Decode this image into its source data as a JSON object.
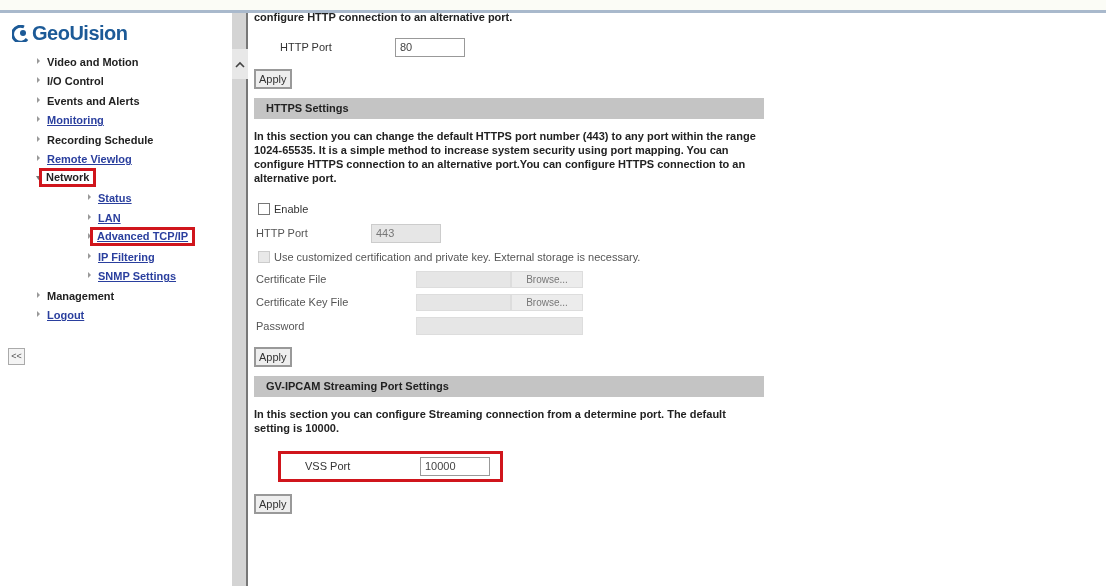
{
  "logo": {
    "text": "GeoUision"
  },
  "nav": [
    {
      "label": "Video and Motion",
      "kind": "plain",
      "expanded": false,
      "highlighted": false
    },
    {
      "label": "I/O Control",
      "kind": "plain",
      "expanded": false,
      "highlighted": false
    },
    {
      "label": "Events and Alerts",
      "kind": "plain",
      "expanded": false,
      "highlighted": false
    },
    {
      "label": "Monitoring",
      "kind": "link",
      "expanded": false,
      "highlighted": false
    },
    {
      "label": "Recording Schedule",
      "kind": "plain",
      "expanded": false,
      "highlighted": false
    },
    {
      "label": "Remote Viewlog",
      "kind": "link",
      "expanded": false,
      "highlighted": false
    },
    {
      "label": "Network",
      "kind": "plain",
      "expanded": true,
      "highlighted": true,
      "children": [
        {
          "label": "Status",
          "kind": "link",
          "highlighted": false
        },
        {
          "label": "LAN",
          "kind": "link",
          "highlighted": false
        },
        {
          "label": "Advanced TCP/IP",
          "kind": "link",
          "highlighted": true
        },
        {
          "label": "IP Filtering",
          "kind": "link",
          "highlighted": false
        },
        {
          "label": "SNMP Settings",
          "kind": "link",
          "highlighted": false
        }
      ]
    },
    {
      "label": "Management",
      "kind": "plain",
      "expanded": false,
      "highlighted": false
    },
    {
      "label": "Logout",
      "kind": "link",
      "expanded": false,
      "highlighted": false
    }
  ],
  "collapse_button": "<<",
  "sections": [
    {
      "description": "configure HTTP connection to an alternative port.",
      "rows": [
        {
          "kind": "field",
          "label": "HTTP Port",
          "value": "80",
          "disabled": false,
          "highlighted": false
        }
      ],
      "apply": "Apply"
    },
    {
      "title": "HTTPS Settings",
      "description": "In this section you can change the default HTTPS port number (443) to any port within the range 1024-65535. It is a simple method to increase system security using port mapping. You can configure HTTPS connection to an alternative port.You can configure HTTPS connection to an alternative port.",
      "rows": [
        {
          "kind": "checkbox",
          "label": "Enable",
          "checked": false,
          "disabled": false
        },
        {
          "kind": "field",
          "label": "HTTP Port",
          "value": "443",
          "disabled": true,
          "highlighted": false
        },
        {
          "kind": "checkbox",
          "label": "Use customized certification and private key. External storage is necessary.",
          "checked": false,
          "disabled": true
        },
        {
          "kind": "file",
          "label": "Certificate File",
          "button": "Browse...",
          "disabled": true
        },
        {
          "kind": "file",
          "label": "Certificate Key File",
          "button": "Browse...",
          "disabled": true
        },
        {
          "kind": "password",
          "label": "Password",
          "disabled": true
        }
      ],
      "apply": "Apply"
    },
    {
      "title": "GV-IPCAM Streaming Port Settings",
      "description": "In this section you can configure Streaming connection from a determine port. The default setting is 10000.",
      "rows": [
        {
          "kind": "field",
          "label": "VSS Port",
          "value": "10000",
          "disabled": false,
          "highlighted": true
        }
      ],
      "apply": "Apply"
    }
  ]
}
